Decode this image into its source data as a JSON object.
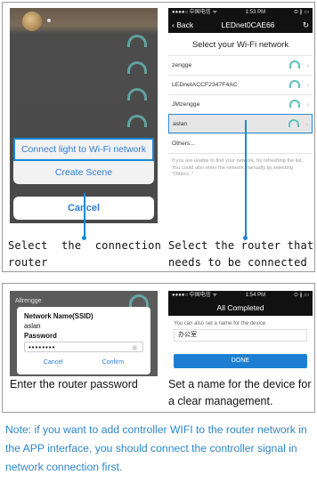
{
  "panel1": {
    "left": {
      "menu_items": [
        "Connect light to Wi-Fi network",
        "Create Scene"
      ],
      "cancel_label": "Cancel"
    },
    "right": {
      "status_left": "●●●●○ 中国电信 ᯤ",
      "status_time": "1:53 PM",
      "status_right": "⊙ ∦ ▭",
      "back_label": "Back",
      "nav_title": "LEDnet0CAE66",
      "heading": "Select your Wi-Fi network",
      "networks": [
        "zengge",
        "LEDnetACCF2347F4AC",
        "JMzengge",
        "aslan",
        "Others..."
      ],
      "selected_network": "aslan",
      "help_text": "If you are unable to find your network, try refreshing the list. You could also enter the network manually by selecting \"Others..\""
    },
    "caption_left": "Select the connection router",
    "caption_right": "Select the router that needs to be connected"
  },
  "panel2": {
    "left": {
      "bg_network": "Allrengge",
      "ssid_label": "Network Name(SSID)",
      "ssid_value": "aslan",
      "password_label": "Password",
      "password_value": "••••••••",
      "cancel_label": "Cancel",
      "confirm_label": "Confirm"
    },
    "right": {
      "status_left": "●●●●○ 中国电信 ᯤ",
      "status_time": "1:54 PM",
      "status_right": "⊙ ∦ ▭",
      "nav_title": "All Completed",
      "hint": "You can also set a name for the device",
      "device_name": "办公室",
      "done_label": "DONE"
    },
    "caption_left": "Enter the router password",
    "caption_right": "Set a name for the device for a clear management."
  },
  "footer_note": "Note: if you want to add controller WIFI to the router network in the APP interface, you should connect the controller signal in network connection first.",
  "colors": {
    "accent": "#1a88d6",
    "note": "#2e86c9",
    "wifi": "#5cc2bb"
  }
}
